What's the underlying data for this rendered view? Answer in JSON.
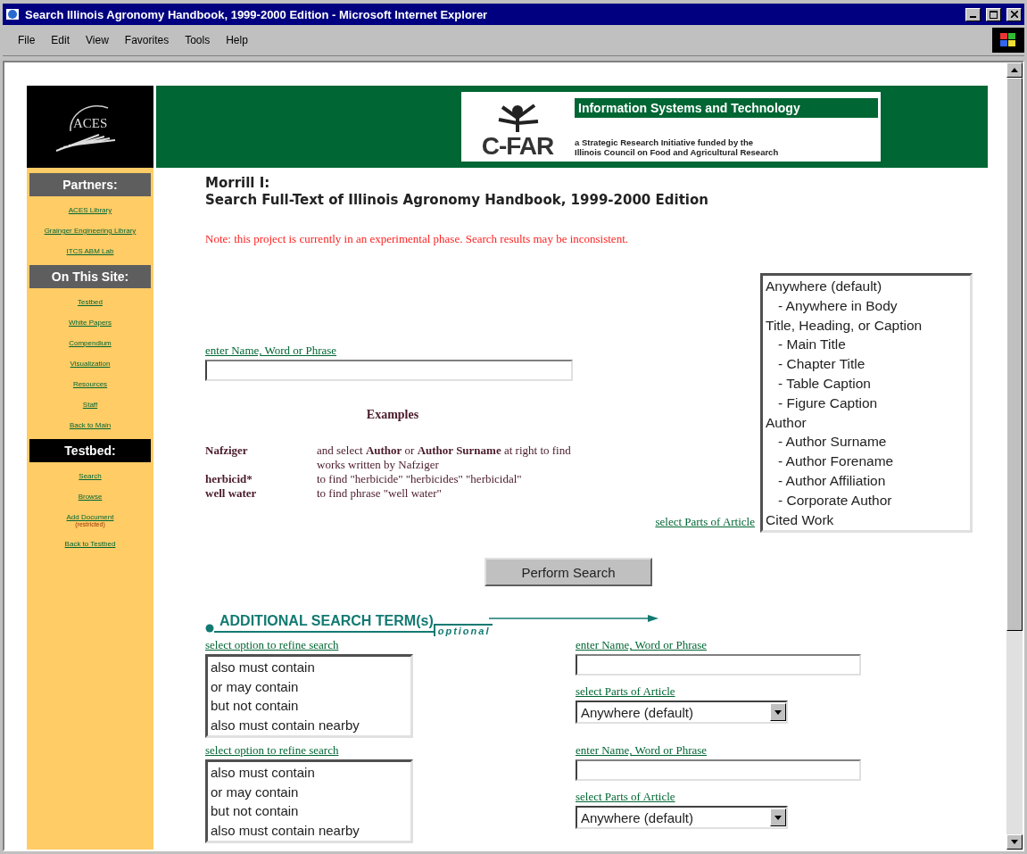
{
  "window": {
    "title": "Search Illinois Agronomy Handbook, 1999-2000 Edition - Microsoft Internet Explorer",
    "menu": [
      "File",
      "Edit",
      "View",
      "Favorites",
      "Tools",
      "Help"
    ]
  },
  "banner": {
    "logo_text": "ACES",
    "cfar": {
      "mark": "C-FAR",
      "title": "Information Systems and Technology",
      "lines": [
        "a Strategic Research Initiative funded by the",
        "Illinois Council on Food and Agricultural Research"
      ]
    }
  },
  "sidebar": {
    "sections": [
      {
        "heading": "Partners:",
        "kind": "secondary",
        "links": [
          {
            "label": "ACES Library"
          },
          {
            "label": "Grainger Engineering Library"
          },
          {
            "label": "ITCS ABM Lab"
          }
        ]
      },
      {
        "heading": "On This Site:",
        "kind": "secondary",
        "links": [
          {
            "label": "Testbed"
          },
          {
            "label": "White Papers"
          },
          {
            "label": "Compendium"
          },
          {
            "label": "Visualization"
          },
          {
            "label": "Resources"
          },
          {
            "label": "Staff"
          },
          {
            "label": "Back to Main"
          }
        ]
      },
      {
        "heading": "Testbed:",
        "kind": "primary",
        "links": [
          {
            "label": "Search"
          },
          {
            "label": "Browse"
          },
          {
            "label": "Add Document",
            "note": "(restricted)"
          },
          {
            "label": "Back to Testbed"
          }
        ]
      }
    ]
  },
  "main": {
    "title_lines": [
      "Morrill I:",
      "Search Full-Text of Illinois Agronomy Handbook, 1999-2000 Edition"
    ],
    "note": "Note: this project is currently in an experimental phase. Search results may be inconsistent.",
    "search": {
      "label": "enter Name, Word or Phrase"
    },
    "examples": {
      "heading": "Examples",
      "rows": [
        {
          "term": "Nafziger",
          "description": "and select **Author** or **Author Surname** at right to find works written by Nafziger"
        },
        {
          "term": "herbicid*",
          "description": "to find \"herbicide\" \"herbicides\" \"herbicidal\""
        },
        {
          "term": "well water",
          "description": "to find phrase \"well water\""
        }
      ]
    },
    "parts": {
      "label": "select Parts of Article",
      "options": [
        {
          "label": "Anywhere (default)",
          "children": [
            {
              "label": "- Anywhere in Body"
            }
          ]
        },
        {
          "label": "Title, Heading, or Caption",
          "children": [
            {
              "label": "- Main Title"
            },
            {
              "label": "- Chapter Title"
            },
            {
              "label": "- Table Caption"
            },
            {
              "label": "- Figure Caption"
            }
          ]
        },
        {
          "label": "Author",
          "children": [
            {
              "label": "- Author Surname"
            },
            {
              "label": "- Author Forename"
            },
            {
              "label": "- Author Affiliation"
            },
            {
              "label": "- Corporate Author"
            }
          ]
        },
        {
          "label": "Cited Work"
        }
      ]
    },
    "submit": "Perform Search",
    "additional": {
      "heading": "ADDITIONAL SEARCH TERM(s)",
      "tag": "optional",
      "rows": [
        {
          "refine_label": "select option to refine search",
          "refine_options": [
            "also must contain",
            "or may contain",
            "but not contain",
            "also must contain nearby"
          ],
          "term_label": "enter Name, Word or Phrase",
          "parts_label": "select Parts of Article",
          "parts_value": "Anywhere (default)"
        },
        {
          "refine_label": "select option to refine search",
          "refine_options": [
            "also must contain",
            "or may contain",
            "but not contain",
            "also must contain nearby"
          ],
          "term_label": "enter Name, Word or Phrase",
          "parts_label": "select Parts of Article",
          "parts_value": "Anywhere (default)"
        }
      ]
    }
  }
}
